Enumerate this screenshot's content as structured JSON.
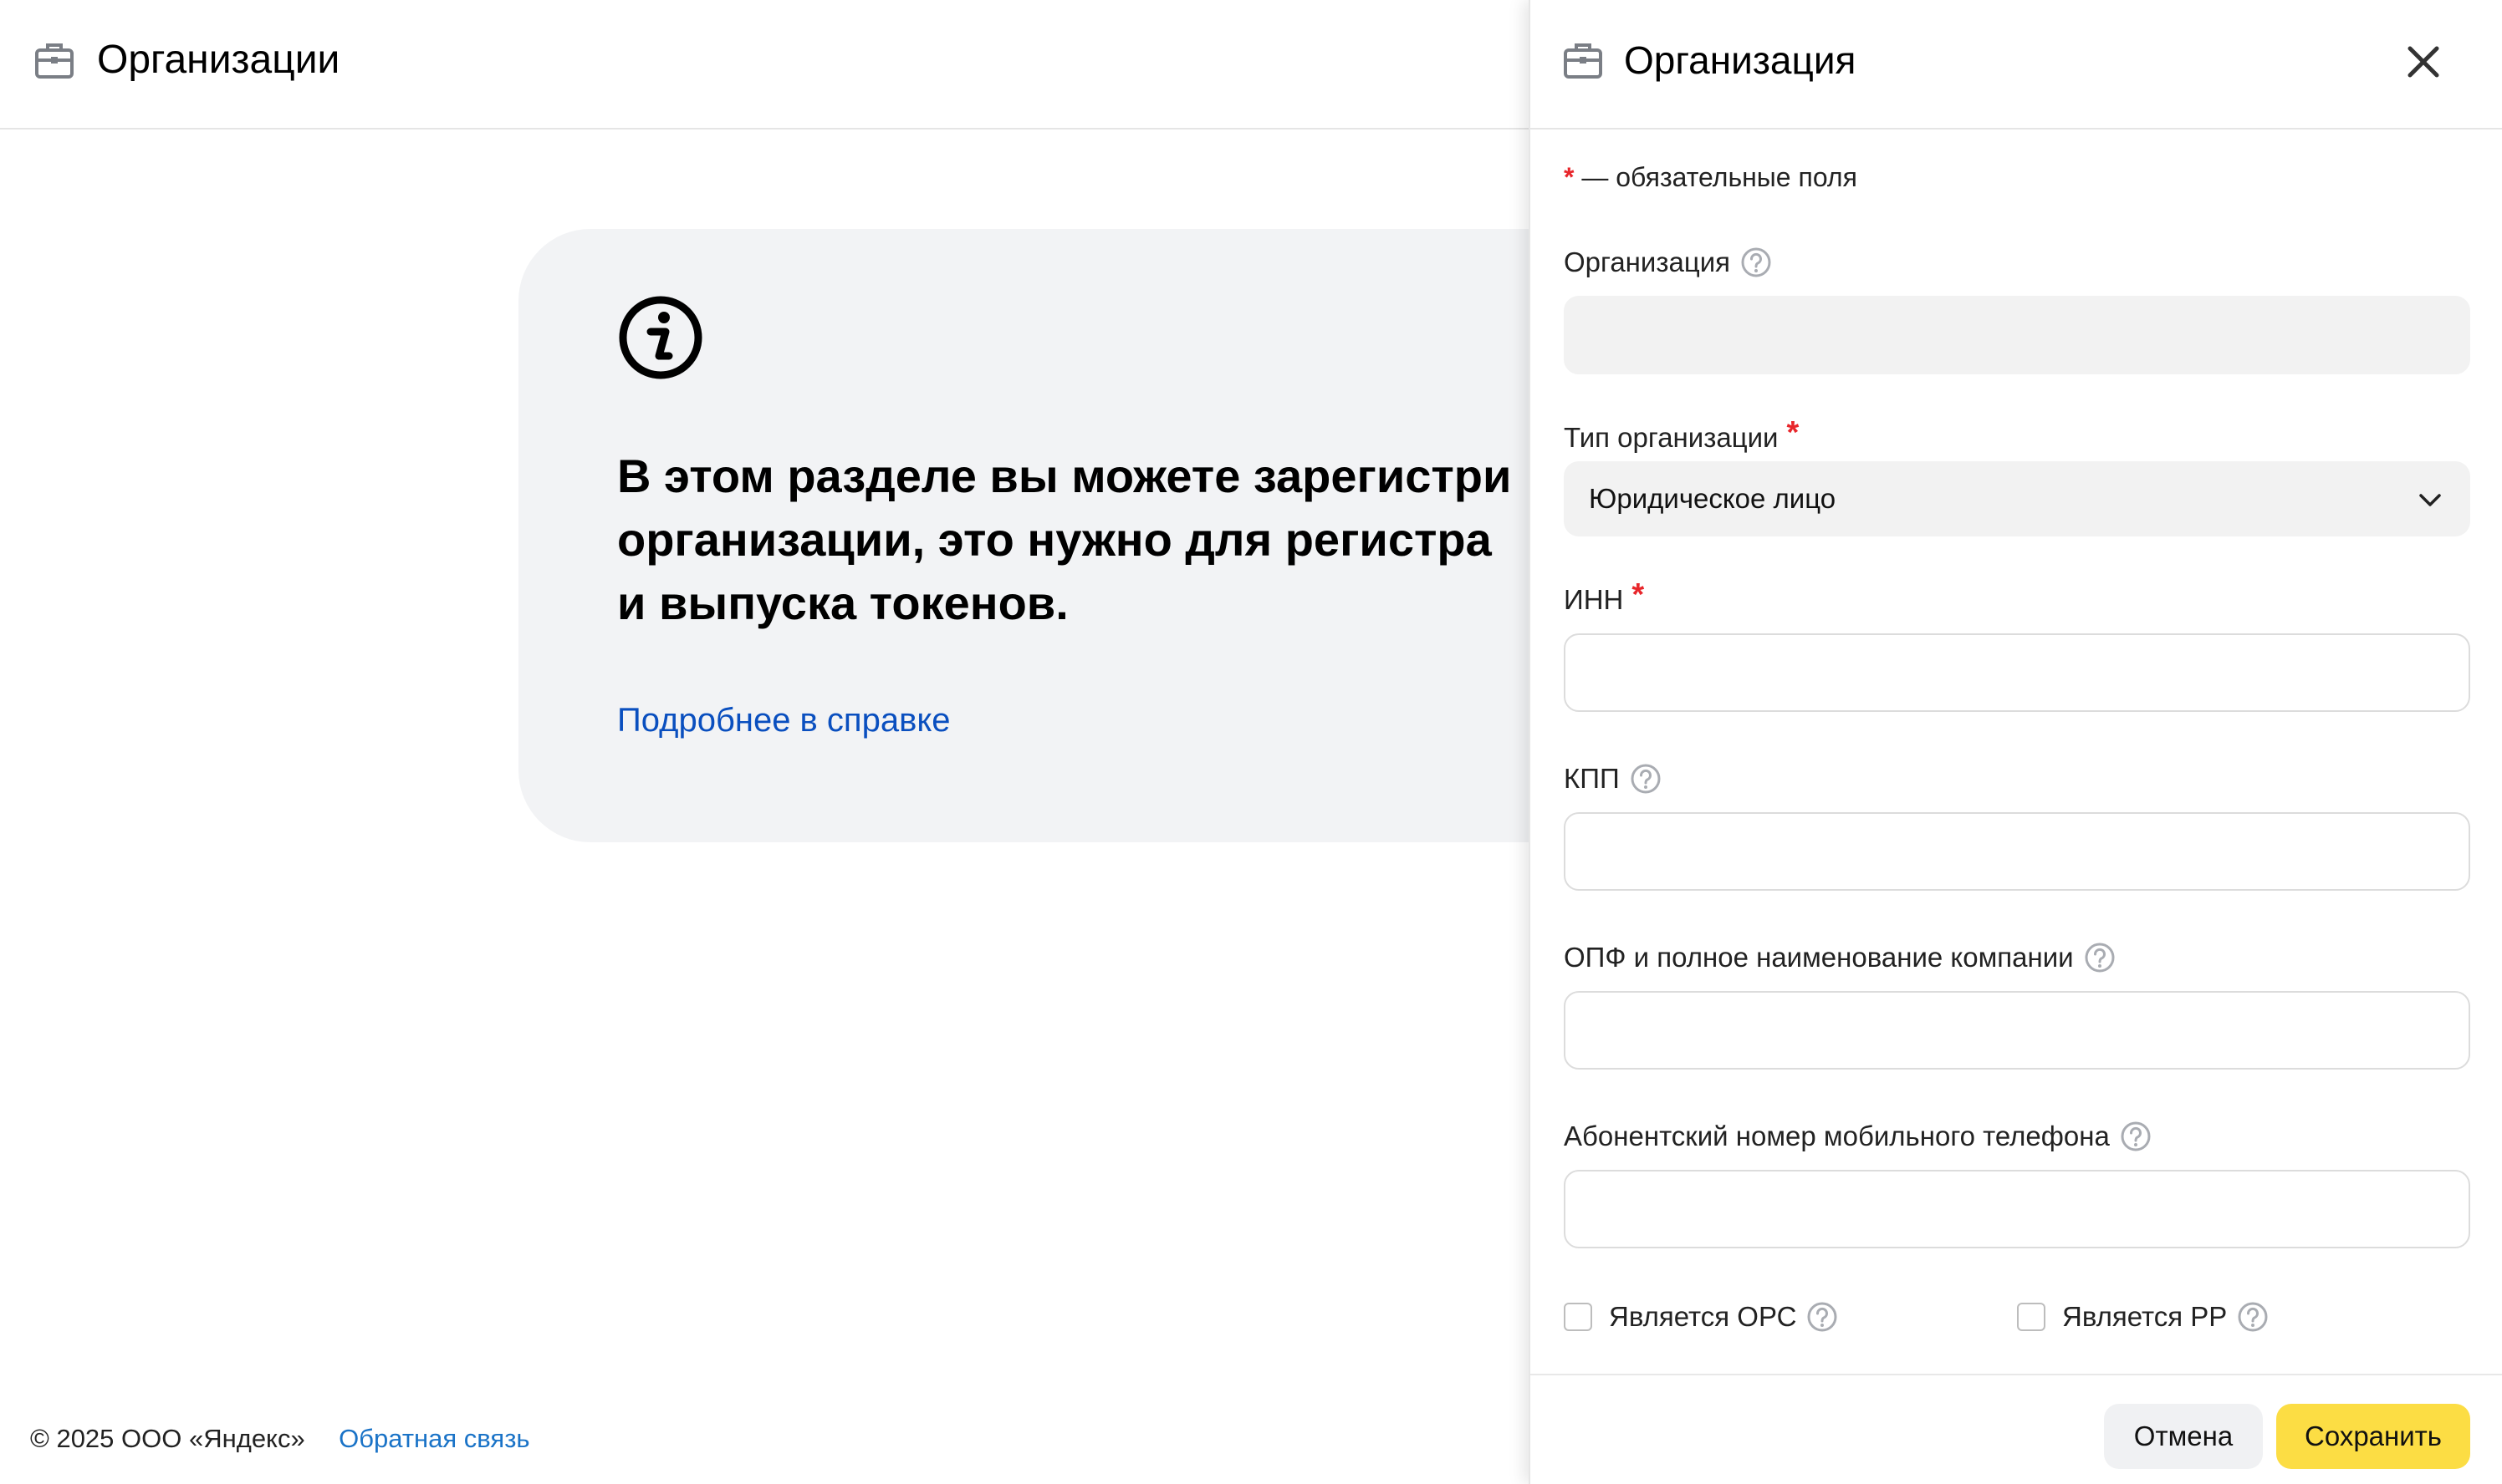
{
  "page": {
    "title": "Организации",
    "info_card": {
      "lines": [
        "В этом разделе вы можете зарегистри",
        "организации, это нужно для регистра",
        "и выпуска токенов."
      ],
      "link_text": "Подробнее в справке"
    },
    "footer": {
      "copyright": "© 2025 ООО «Яндекс»",
      "feedback_link": "Обратная связь"
    }
  },
  "panel": {
    "title": "Организация",
    "required_note_star": "*",
    "required_note_text": " — обязательные поля",
    "fields": {
      "organization": {
        "label": "Организация",
        "value": ""
      },
      "org_type": {
        "label": "Тип организации",
        "required_star": "*",
        "value": "Юридическое лицо"
      },
      "inn": {
        "label": "ИНН",
        "required_star": "*",
        "value": ""
      },
      "kpp": {
        "label": "КПП",
        "value": ""
      },
      "opf_name": {
        "label": "ОПФ и полное наименование компании",
        "value": ""
      },
      "phone": {
        "label": "Абонентский номер мобильного телефона",
        "value": ""
      }
    },
    "checkboxes": {
      "ors": {
        "label": "Является ОРС",
        "checked": false
      },
      "rr": {
        "label": "Является РР",
        "checked": false
      }
    },
    "buttons": {
      "cancel": "Отмена",
      "save": "Сохранить"
    }
  },
  "colors": {
    "required_star": "#e8262b",
    "link": "#0a4fbf",
    "save_button": "#fcdd44",
    "info_card_bg": "#f2f3f5"
  },
  "icons": {
    "header": "briefcase-icon",
    "info": "info-circle-icon",
    "close": "close-icon",
    "help": "question-circle-icon",
    "dropdown": "chevron-down-icon"
  }
}
